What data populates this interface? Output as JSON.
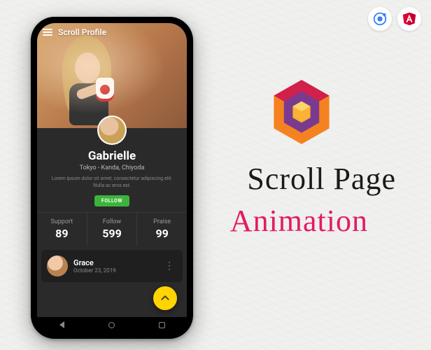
{
  "badges": {
    "ionic": "ionic-logo",
    "angular": "angular-logo"
  },
  "marketing": {
    "title1": "Scroll Page",
    "title2": "Animation"
  },
  "app": {
    "header_title": "Scroll Profile",
    "profile": {
      "name": "Gabrielle",
      "location": "Tokyo - Kanda, Chiyoda",
      "bio": "Lorem ipsum dolor sit amet, consectetur adipiscing elit. Nulla ac eros est.",
      "follow_label": "FOLLOW"
    },
    "stats": [
      {
        "label": "Support",
        "value": "89"
      },
      {
        "label": "Follow",
        "value": "599"
      },
      {
        "label": "Praise",
        "value": "99"
      }
    ],
    "list": [
      {
        "name": "Grace",
        "date": "October 23, 2019"
      }
    ]
  }
}
